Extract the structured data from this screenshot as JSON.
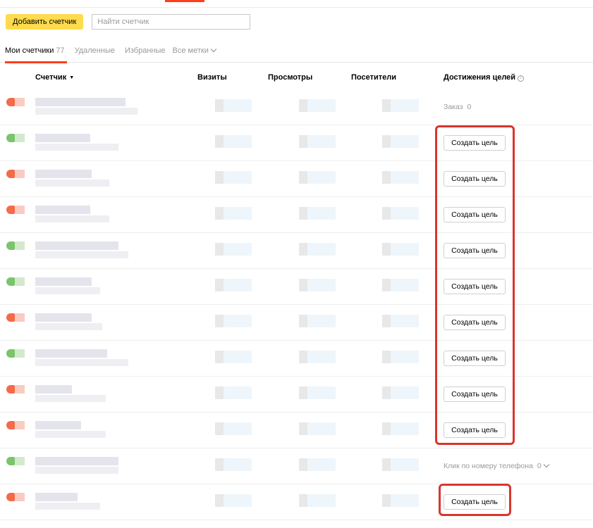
{
  "toolbar": {
    "add_button": "Добавить счетчик",
    "search_placeholder": "Найти счетчик"
  },
  "tabs": {
    "my_counters": "Мои счетчики",
    "my_counters_count": "77",
    "deleted": "Удаленные",
    "favorites": "Избранные",
    "all_tags": "Все метки"
  },
  "table": {
    "columns": {
      "counter": "Счетчик",
      "visits": "Визиты",
      "views": "Просмотры",
      "visitors": "Посетители",
      "goals": "Достижения целей"
    }
  },
  "rows": [
    {
      "status": "red",
      "goal_type": "text",
      "goal_label": "Заказ",
      "goal_count": "0"
    },
    {
      "status": "green",
      "goal_type": "button",
      "goal_label": "Создать цель"
    },
    {
      "status": "red",
      "goal_type": "button",
      "goal_label": "Создать цель"
    },
    {
      "status": "red",
      "goal_type": "button",
      "goal_label": "Создать цель"
    },
    {
      "status": "green",
      "goal_type": "button",
      "goal_label": "Создать цель"
    },
    {
      "status": "green",
      "goal_type": "button",
      "goal_label": "Создать цель"
    },
    {
      "status": "red",
      "goal_type": "button",
      "goal_label": "Создать цель"
    },
    {
      "status": "green",
      "goal_type": "button",
      "goal_label": "Создать цель"
    },
    {
      "status": "red",
      "goal_type": "button",
      "goal_label": "Создать цель"
    },
    {
      "status": "red",
      "goal_type": "button",
      "goal_label": "Создать цель"
    },
    {
      "status": "green",
      "goal_type": "text",
      "goal_label": "Клик по номеру телефона",
      "goal_count": "0"
    },
    {
      "status": "red",
      "goal_type": "button",
      "goal_label": "Создать цель"
    }
  ],
  "colors": {
    "accent": "#fc3f1d",
    "button_yellow": "#ffdb4d",
    "highlight": "#d9352e",
    "status_red": "#f26b4a",
    "status_green": "#7cc36d"
  }
}
